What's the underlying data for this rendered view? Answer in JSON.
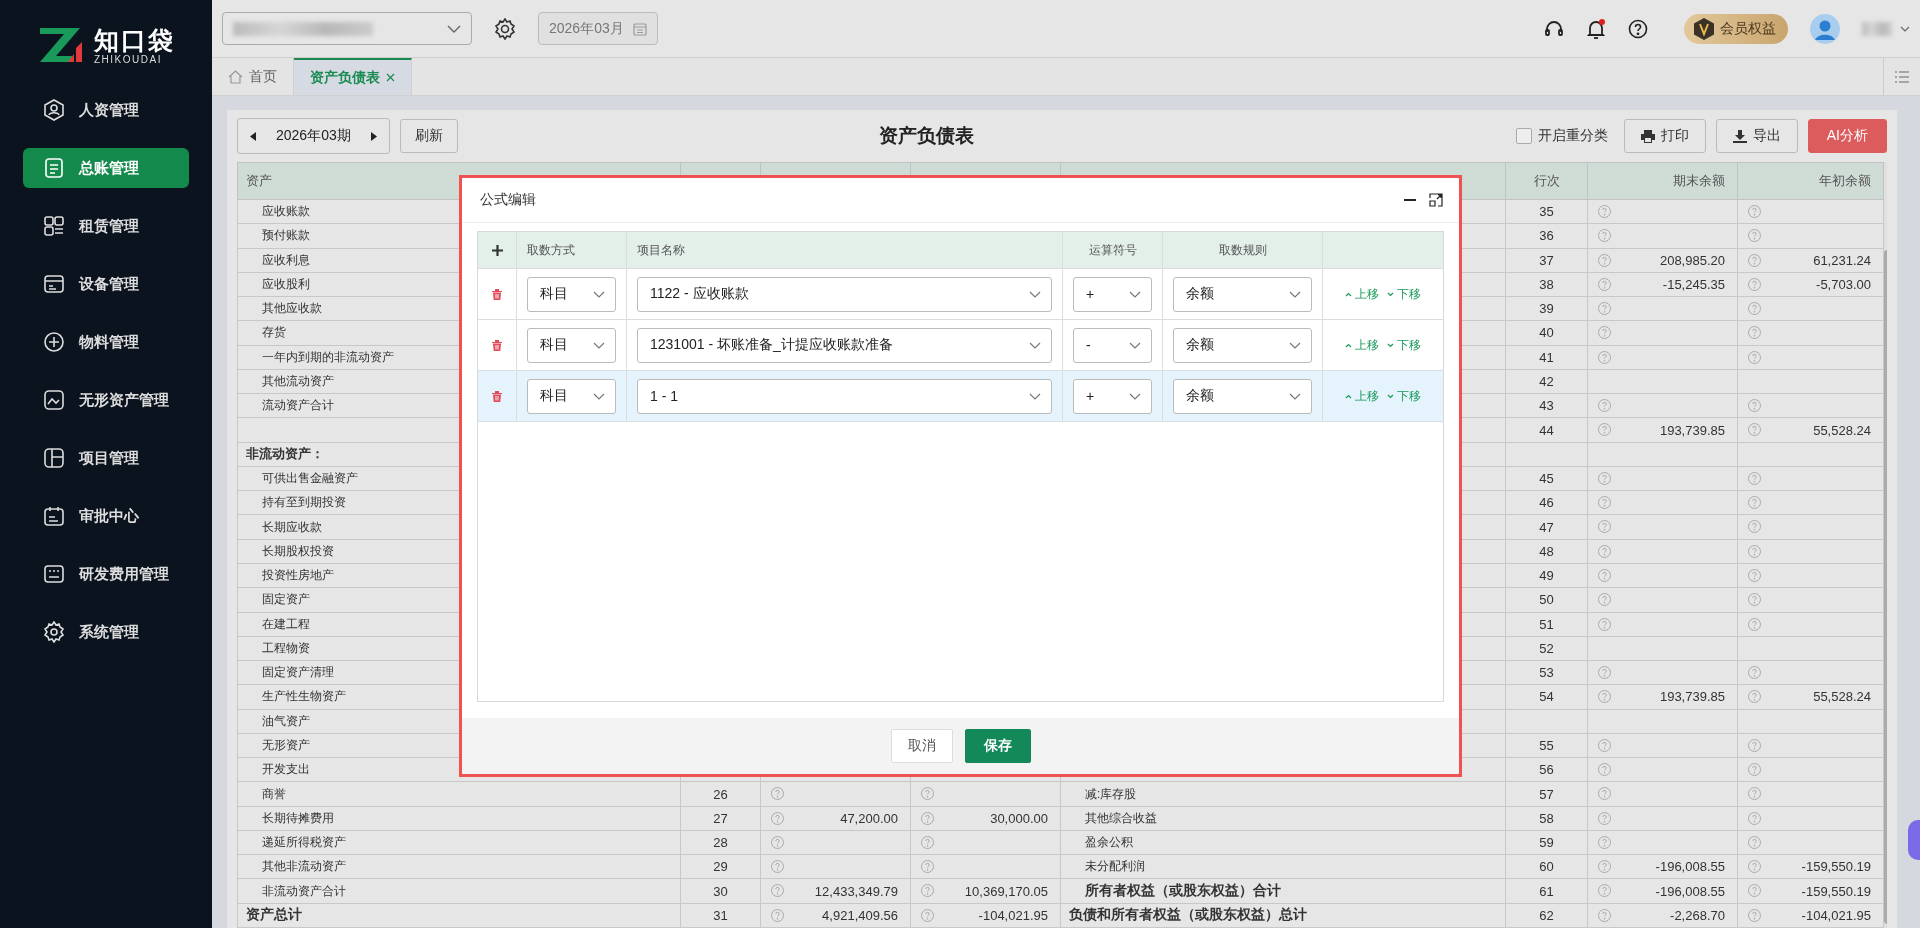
{
  "brand": {
    "name": "知口袋",
    "subtitle": "ZHIKOUDAI"
  },
  "sidebar": {
    "items": [
      {
        "label": "人资管理",
        "selected": false
      },
      {
        "label": "总账管理",
        "selected": true
      },
      {
        "label": "租赁管理",
        "selected": false
      },
      {
        "label": "设备管理",
        "selected": false
      },
      {
        "label": "物料管理",
        "selected": false
      },
      {
        "label": "无形资产管理",
        "selected": false
      },
      {
        "label": "项目管理",
        "selected": false
      },
      {
        "label": "审批中心",
        "selected": false
      },
      {
        "label": "研发费用管理",
        "selected": false
      },
      {
        "label": "系统管理",
        "selected": false
      }
    ]
  },
  "topbar": {
    "month": "2026年03月",
    "member": "会员权益",
    "notification_dot": true
  },
  "tabs": [
    {
      "label": "首页",
      "selected": false,
      "closable": false
    },
    {
      "label": "资产负债表",
      "selected": true,
      "closable": true
    }
  ],
  "toolbar": {
    "period": "2026年03期",
    "refresh": "刷新",
    "title": "资产负债表",
    "reclassify": {
      "label": "开启重分类",
      "checked": false
    },
    "print": "打印",
    "export": "导出",
    "ai": "AI分析"
  },
  "table": {
    "header": {
      "left_name": "资产",
      "right_line": "行次",
      "right_end": "期末余额",
      "right_begin": "年初余额"
    },
    "rows": [
      {
        "left": {
          "name": "应收账款",
          "kind": "item"
        },
        "right": {
          "line": "35",
          "end": {
            "hint": true
          },
          "begin": {
            "hint": true
          }
        }
      },
      {
        "left": {
          "name": "预付账款",
          "kind": "item"
        },
        "right": {
          "line": "36",
          "end": {
            "hint": true
          },
          "begin": {
            "hint": true
          }
        }
      },
      {
        "left": {
          "name": "应收利息",
          "kind": "item"
        },
        "right": {
          "line": "37",
          "end": {
            "hint": true,
            "value": "208,985.20"
          },
          "begin": {
            "hint": true,
            "value": "61,231.24"
          }
        }
      },
      {
        "left": {
          "name": "应收股利",
          "kind": "item"
        },
        "right": {
          "line": "38",
          "end": {
            "hint": true,
            "value": "-15,245.35"
          },
          "begin": {
            "hint": true,
            "value": "-5,703.00"
          }
        }
      },
      {
        "left": {
          "name": "其他应收款",
          "kind": "item"
        },
        "right": {
          "line": "39",
          "end": {
            "hint": true
          },
          "begin": {
            "hint": true
          }
        }
      },
      {
        "left": {
          "name": "存货",
          "kind": "item"
        },
        "right": {
          "line": "40",
          "end": {
            "hint": true
          },
          "begin": {
            "hint": true
          }
        }
      },
      {
        "left": {
          "name": "一年内到期的非流动资产",
          "kind": "item"
        },
        "right": {
          "line": "41",
          "end": {
            "hint": true
          },
          "begin": {
            "hint": true
          }
        }
      },
      {
        "left": {
          "name": "其他流动资产",
          "kind": "item"
        },
        "right": {
          "line": "42"
        }
      },
      {
        "left": {
          "name": "流动资产合计",
          "kind": "item"
        },
        "right": {
          "line": "43",
          "end": {
            "hint": true
          },
          "begin": {
            "hint": true
          }
        }
      },
      {
        "left": {
          "kind": "blank"
        },
        "right": {
          "line": "44",
          "end": {
            "hint": true,
            "value": "193,739.85"
          },
          "begin": {
            "hint": true,
            "value": "55,528.24"
          }
        }
      },
      {
        "left": {
          "name": "非流动资产：",
          "kind": "section"
        },
        "right": {}
      },
      {
        "left": {
          "name": "可供出售金融资产",
          "kind": "item"
        },
        "right": {
          "line": "45",
          "end": {
            "hint": true
          },
          "begin": {
            "hint": true
          }
        }
      },
      {
        "left": {
          "name": "持有至到期投资",
          "kind": "item"
        },
        "right": {
          "line": "46",
          "end": {
            "hint": true
          },
          "begin": {
            "hint": true
          }
        }
      },
      {
        "left": {
          "name": "长期应收款",
          "kind": "item"
        },
        "right": {
          "line": "47",
          "end": {
            "hint": true
          },
          "begin": {
            "hint": true
          }
        }
      },
      {
        "left": {
          "name": "长期股权投资",
          "kind": "item"
        },
        "right": {
          "line": "48",
          "end": {
            "hint": true
          },
          "begin": {
            "hint": true
          }
        }
      },
      {
        "left": {
          "name": "投资性房地产",
          "kind": "item"
        },
        "right": {
          "line": "49",
          "end": {
            "hint": true
          },
          "begin": {
            "hint": true
          }
        }
      },
      {
        "left": {
          "name": "固定资产",
          "kind": "item"
        },
        "right": {
          "line": "50",
          "end": {
            "hint": true
          },
          "begin": {
            "hint": true
          }
        }
      },
      {
        "left": {
          "name": "在建工程",
          "kind": "item"
        },
        "right": {
          "line": "51",
          "end": {
            "hint": true
          },
          "begin": {
            "hint": true
          }
        }
      },
      {
        "left": {
          "name": "工程物资",
          "kind": "item"
        },
        "right": {
          "line": "52"
        }
      },
      {
        "left": {
          "name": "固定资产清理",
          "kind": "item"
        },
        "right": {
          "line": "53",
          "end": {
            "hint": true
          },
          "begin": {
            "hint": true
          }
        }
      },
      {
        "left": {
          "name": "生产性生物资产",
          "kind": "item"
        },
        "right": {
          "line": "54",
          "end": {
            "hint": true,
            "value": "193,739.85"
          },
          "begin": {
            "hint": true,
            "value": "55,528.24"
          }
        }
      },
      {
        "left": {
          "name": "油气资产",
          "kind": "item"
        },
        "right": {}
      },
      {
        "left": {
          "name": "无形资产",
          "kind": "item"
        },
        "right": {
          "line": "55",
          "end": {
            "hint": true
          },
          "begin": {
            "hint": true
          }
        }
      },
      {
        "left": {
          "name": "开发支出",
          "kind": "item"
        },
        "right": {
          "line": "56",
          "end": {
            "hint": true
          },
          "begin": {
            "hint": true
          }
        }
      },
      {
        "left": {
          "name": "商誉",
          "kind": "item",
          "line": "26",
          "end": {
            "hint": true
          },
          "begin": {
            "hint": true
          }
        },
        "right": {
          "name": "减:库存股",
          "kind": "item",
          "line": "57",
          "end": {
            "hint": true
          },
          "begin": {
            "hint": true
          }
        }
      },
      {
        "left": {
          "name": "长期待摊费用",
          "kind": "item",
          "line": "27",
          "end": {
            "hint": true,
            "value": "47,200.00"
          },
          "begin": {
            "hint": true,
            "value": "30,000.00"
          }
        },
        "right": {
          "name": "其他综合收益",
          "kind": "item",
          "line": "58",
          "end": {
            "hint": true
          },
          "begin": {
            "hint": true
          }
        }
      },
      {
        "left": {
          "name": "递延所得税资产",
          "kind": "item",
          "line": "28",
          "end": {
            "hint": true
          },
          "begin": {
            "hint": true
          }
        },
        "right": {
          "name": "盈余公积",
          "kind": "item",
          "line": "59",
          "end": {
            "hint": true
          },
          "begin": {
            "hint": true
          }
        }
      },
      {
        "left": {
          "name": "其他非流动资产",
          "kind": "item",
          "line": "29",
          "end": {
            "hint": true
          },
          "begin": {
            "hint": true
          }
        },
        "right": {
          "name": "未分配利润",
          "kind": "item",
          "line": "60",
          "end": {
            "hint": true,
            "value": "-196,008.55"
          },
          "begin": {
            "hint": true,
            "value": "-159,550.19"
          }
        }
      },
      {
        "left": {
          "name": "非流动资产合计",
          "kind": "item",
          "line": "30",
          "end": {
            "hint": true,
            "value": "12,433,349.79"
          },
          "begin": {
            "hint": true,
            "value": "10,369,170.05"
          }
        },
        "right": {
          "name": "所有者权益（或股东权益）合计",
          "kind": "subtotal",
          "line": "61",
          "end": {
            "hint": true,
            "value": "-196,008.55"
          },
          "begin": {
            "hint": true,
            "value": "-159,550.19"
          }
        }
      },
      {
        "left": {
          "name": "资产总计",
          "kind": "total",
          "line": "31",
          "end": {
            "hint": true,
            "value": "4,921,409.56"
          },
          "begin": {
            "hint": true,
            "value": "-104,021.95"
          }
        },
        "right": {
          "name": "负债和所有者权益（或股东权益）总计",
          "kind": "total",
          "line": "62",
          "end": {
            "hint": true,
            "value": "-2,268.70"
          },
          "begin": {
            "hint": true,
            "value": "-104,021.95"
          }
        }
      }
    ]
  },
  "dialog": {
    "title": "公式编辑",
    "columns": [
      "取数方式",
      "项目名称",
      "运算符号",
      "取数规则"
    ],
    "rows": [
      {
        "source": "科目",
        "item": "1122 - 应收账款",
        "operator": "+",
        "rule": "余额",
        "up": "上移",
        "down": "下移",
        "selected": false
      },
      {
        "source": "科目",
        "item": "1231001 - 坏账准备_计提应收账款准备",
        "operator": "-",
        "rule": "余额",
        "up": "上移",
        "down": "下移",
        "selected": false
      },
      {
        "source": "科目",
        "item": "1 - 1",
        "operator": "+",
        "rule": "余额",
        "up": "上移",
        "down": "下移",
        "selected": true
      }
    ],
    "cancel": "取消",
    "save": "保存"
  }
}
